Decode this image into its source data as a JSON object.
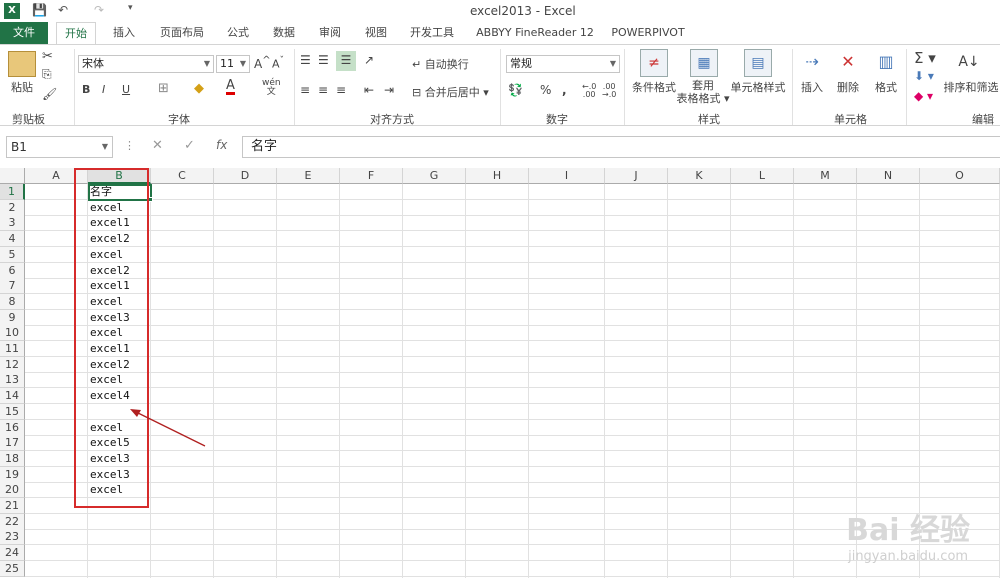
{
  "window": {
    "title": "excel2013 - Excel"
  },
  "tabs": [
    "文件",
    "开始",
    "插入",
    "页面布局",
    "公式",
    "数据",
    "审阅",
    "视图",
    "开发工具",
    "ABBYY FineReader 12",
    "POWERPIVOT"
  ],
  "ribbon": {
    "clipboard": {
      "paste": "粘贴",
      "label": "剪贴板"
    },
    "font": {
      "name": "宋体",
      "size": "11",
      "label": "字体",
      "bold": "B",
      "italic": "I",
      "underline": "U",
      "wen": "wén"
    },
    "alignment": {
      "wrap": "自动换行",
      "merge": "合并后居中",
      "label": "对齐方式"
    },
    "number": {
      "format": "常规",
      "label": "数字",
      "percent": "%",
      "comma": ","
    },
    "styles": {
      "conditional": "条件格式",
      "table_line1": "套用",
      "table_line2": "表格格式",
      "cell_styles": "单元格样式",
      "label": "样式"
    },
    "cells": {
      "insert": "插入",
      "delete": "删除",
      "format": "格式",
      "label": "单元格"
    },
    "editing": {
      "sort": "排序和筛选",
      "label": "编辑"
    }
  },
  "formula_bar": {
    "name_box": "B1",
    "content": "名字",
    "fx": "fx"
  },
  "columns": [
    "A",
    "B",
    "C",
    "D",
    "E",
    "F",
    "G",
    "H",
    "I",
    "J",
    "K",
    "L",
    "M",
    "N",
    "O"
  ],
  "rows": [
    "1",
    "2",
    "3",
    "4",
    "5",
    "6",
    "7",
    "8",
    "9",
    "10",
    "11",
    "12",
    "13",
    "14",
    "15",
    "16",
    "17",
    "18",
    "19",
    "20",
    "21",
    "22",
    "23",
    "24",
    "25"
  ],
  "cells_B": [
    "名字",
    "excel",
    "excel1",
    "excel2",
    "excel",
    "excel2",
    "excel1",
    "excel",
    "excel3",
    "excel",
    "excel1",
    "excel2",
    "excel",
    "excel4",
    "",
    "excel",
    "excel5",
    "excel3",
    "excel3",
    "excel"
  ],
  "watermark": {
    "main": "Bai  经验",
    "sub": "jingyan.baidu.com"
  }
}
